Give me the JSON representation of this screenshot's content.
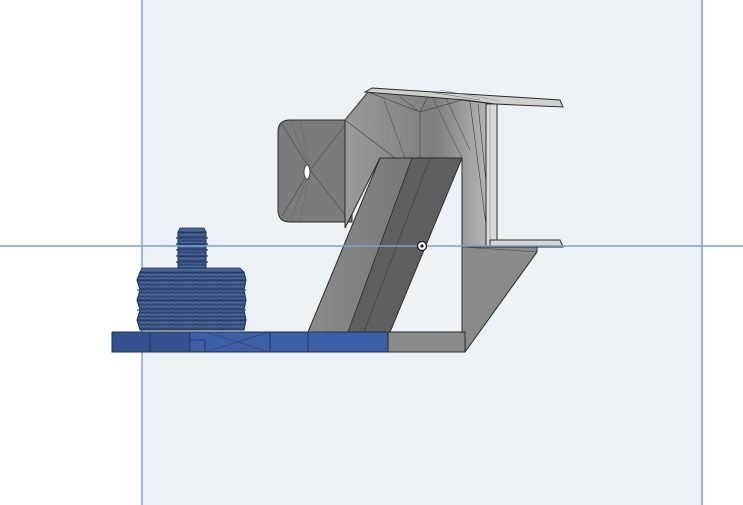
{
  "app": {
    "view": "cad-3d-viewport"
  },
  "colors": {
    "background": "#ffffff",
    "sketch_plane": "#edf2f7",
    "plane_edge": "#7aa2d6",
    "mount_body": "#7d7d7d",
    "mount_dark": "#5e5e5e",
    "mount_light": "#9a9a9a",
    "selected_face": "#3d5fa8",
    "screw_blue": "#3b5687",
    "edge_line": "#2a2a2a"
  },
  "icons": {
    "origin": "origin-point-icon"
  }
}
